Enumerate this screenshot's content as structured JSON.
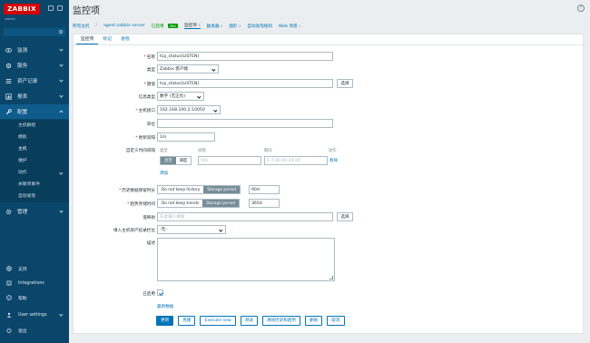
{
  "app": {
    "logo": "ZABBIX",
    "server": "zabbix"
  },
  "nav": {
    "monitoring": "监测",
    "services": "服务",
    "inventory": "资产记录",
    "reports": "报表",
    "configuration": "配置",
    "admin": "管理"
  },
  "submenu": [
    "主机群组",
    "模板",
    "主机",
    "维护",
    "动作",
    "关联项事件",
    "自动发现"
  ],
  "footer": {
    "support": "支持",
    "integrations": "Integrations",
    "help": "帮助",
    "user_settings": "User settings",
    "signout": "退出"
  },
  "page": {
    "title": "监控项",
    "help": "?"
  },
  "breadcrumb": {
    "all_hosts": "所有主机",
    "sep": "/",
    "host": "agent.zabbix server",
    "enabled": "已启用",
    "zbx": "ZBX",
    "items": "监控项",
    "items_count": "5",
    "triggers": "触发器",
    "triggers_count": "2",
    "graphs": "图形",
    "graphs_count": "3",
    "discovery": "自动发现规则",
    "web": "Web 场景",
    "web_count": "1"
  },
  "tabs": [
    "监控项",
    "标记",
    "进程"
  ],
  "form": {
    "name_label": "名称",
    "name_value": "tcp_status[LISTEN]",
    "type_label": "类型",
    "type_value": "Zabbix 客户端",
    "key_label": "键值",
    "key_value": "tcp_status[LISTEN]",
    "select": "选择",
    "info_type_label": "信息类型",
    "info_type_value": "数字 (无正负)",
    "interface_label": "主机接口",
    "interface_value": "192.168.100.2:10050",
    "units_label": "单位",
    "interval_label": "更新间隔",
    "interval_value": "1m",
    "custom_label": "自定义时间间隔",
    "col_type": "类型",
    "col_interval": "间隔",
    "col_period": "期间",
    "col_action": "动作",
    "flexible": "灵活",
    "scheduling": "调度",
    "flex_interval_ph": "50s",
    "flex_period_ph": "1-7,00:00-24:00",
    "remove": "移除",
    "add": "添加",
    "history_label": "历史数据保留时长",
    "no_keep_history": "Do not keep history",
    "storage_period": "Storage period",
    "history_value": "90d",
    "trends_label": "趋势存储时间",
    "no_keep_trends": "Do not keep trends",
    "trends_value": "365d",
    "valuemap_label": "值映射",
    "valuemap_ph": "在此输入搜索",
    "inventory_label": "填入主机资产纪录栏位",
    "inventory_value": "-无-",
    "desc_label": "描述",
    "enabled_label": "已启用",
    "latest_data": "最新数据"
  },
  "actions": [
    "更新",
    "克隆",
    "Execute now",
    "测试",
    "清除历史和趋势",
    "删除",
    "取消"
  ]
}
